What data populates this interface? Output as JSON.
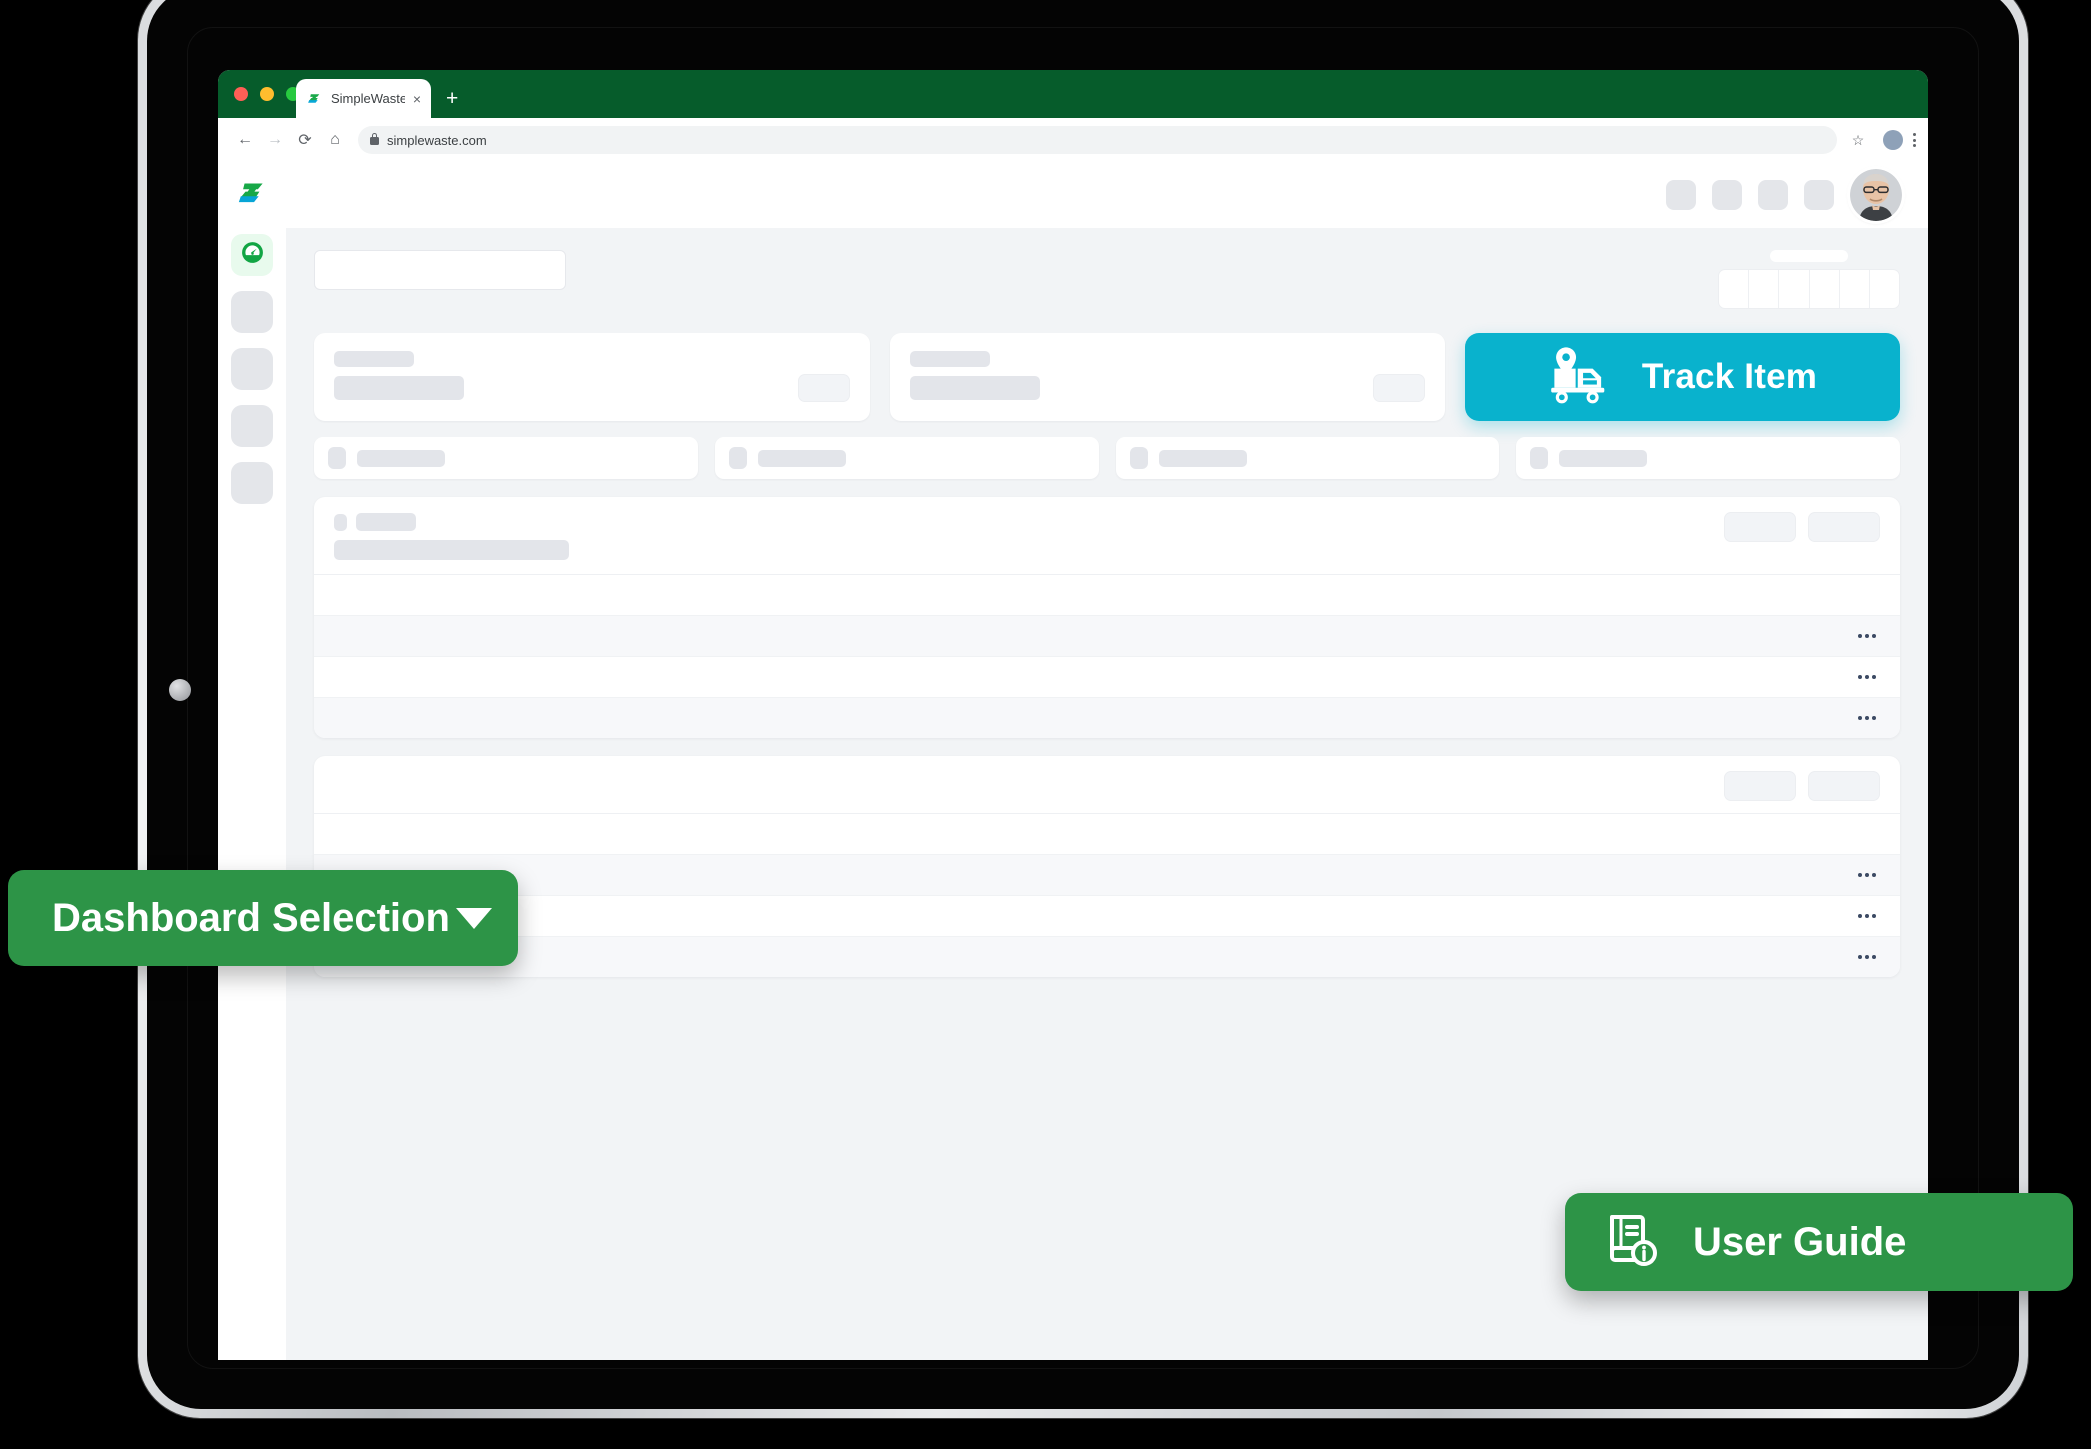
{
  "browser": {
    "tab": {
      "title": "SimpleWaste",
      "favicon": "simplewaste-logo-icon",
      "close_label": "×"
    },
    "new_tab_label": "+",
    "back_icon": "back-arrow-icon",
    "forward_icon": "forward-arrow-icon",
    "reload_icon": "reload-icon",
    "home_icon": "home-icon",
    "address": "simplewaste.com",
    "lock_icon": "lock-icon",
    "bookmark_icon": "star-icon",
    "profile_icon": "browser-profile-icon",
    "menu_icon": "kebab-menu-icon"
  },
  "sidebar": {
    "logo": "simplewaste-logo",
    "items": [
      {
        "name": "dashboard",
        "icon": "gauge-icon",
        "active": true
      },
      {
        "name": "nav-placeholder-1",
        "icon": "placeholder-icon",
        "active": false
      },
      {
        "name": "nav-placeholder-2",
        "icon": "placeholder-icon",
        "active": false
      },
      {
        "name": "nav-placeholder-3",
        "icon": "placeholder-icon",
        "active": false
      },
      {
        "name": "nav-placeholder-4",
        "icon": "placeholder-icon",
        "active": false
      }
    ]
  },
  "topbar": {
    "action_count": 4,
    "avatar": "user-avatar-photo"
  },
  "main": {
    "selector_placeholder": "",
    "range_segments": 6,
    "cards": [
      {
        "id": "card-1"
      },
      {
        "id": "card-2"
      }
    ],
    "track_button": {
      "label": "Track Item",
      "icon": "truck-location-icon",
      "color": "#09b2cd"
    },
    "stats_count": 4,
    "panels": [
      {
        "id": "panel-1",
        "rows": 3,
        "header_actions": 2
      },
      {
        "id": "panel-2",
        "rows": 3,
        "header_actions": 2
      }
    ],
    "row_menu_icon": "ellipsis-icon"
  },
  "callouts": {
    "dashboard_selection": {
      "label": "Dashboard Selection",
      "icon": "chevron-down-icon",
      "color": "#2d9447"
    },
    "user_guide": {
      "label": "User Guide",
      "icon": "book-info-icon",
      "color": "#2d9447"
    }
  },
  "colors": {
    "brand_green": "#2d9447",
    "tabbar_green": "#065c2b",
    "accent_cyan": "#09b2cd",
    "app_bg": "#f2f4f6"
  }
}
